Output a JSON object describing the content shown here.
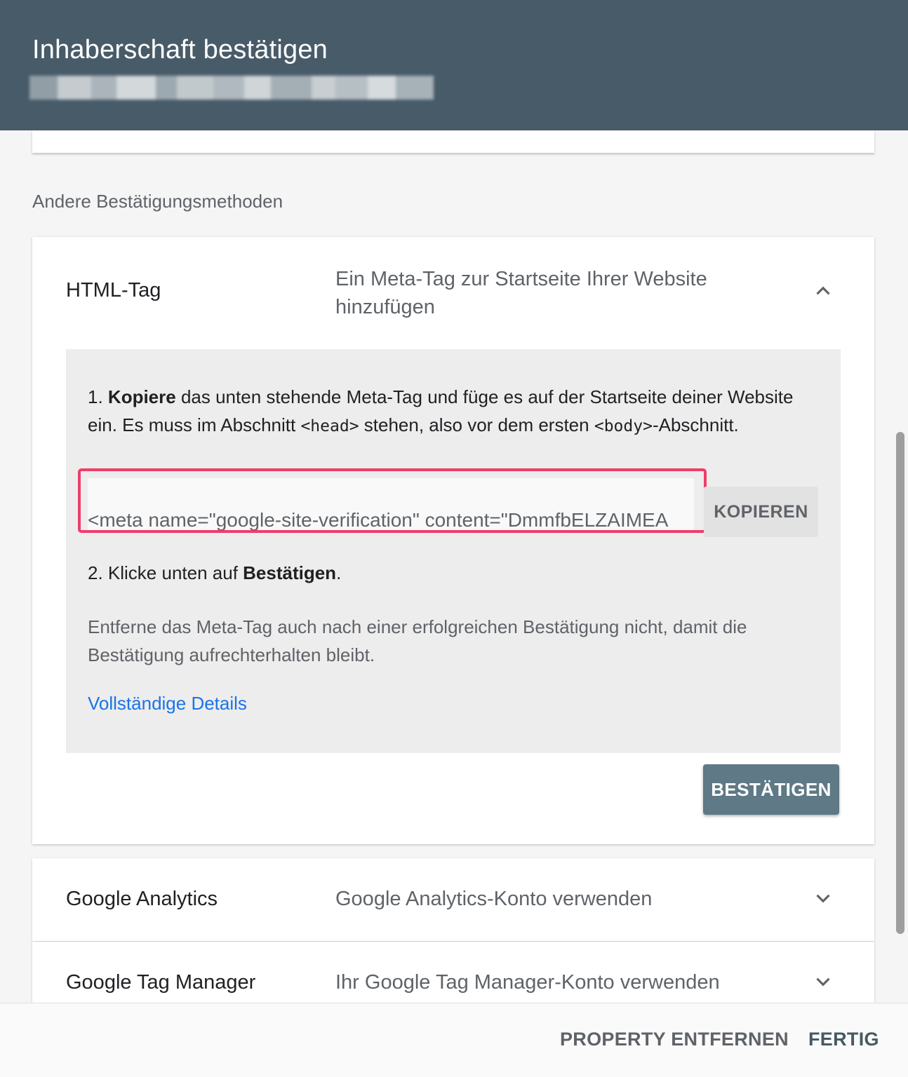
{
  "header": {
    "title": "Inhaberschaft bestätigen",
    "subtitle_redacted": true
  },
  "section": {
    "label": "Andere Bestätigungsmethoden"
  },
  "methods": [
    {
      "name": "HTML-Tag",
      "description": "Ein Meta-Tag zur Startseite Ihrer Website hinzufügen",
      "expanded": true,
      "chevron_icon": "chevron-up-icon"
    },
    {
      "name": "Google Analytics",
      "description": "Google Analytics-Konto verwenden",
      "expanded": false,
      "chevron_icon": "chevron-down-icon"
    },
    {
      "name": "Google Tag Manager",
      "description": "Ihr Google Tag Manager-Konto verwenden",
      "expanded": false,
      "chevron_icon": "chevron-down-icon"
    }
  ],
  "html_tag": {
    "step1": {
      "number": "1.",
      "bold": "Kopiere",
      "text_a": " das unten stehende Meta-Tag und füge es auf der Startseite deiner Website ein. Es muss im Abschnitt ",
      "code_head": "<head>",
      "text_b": " stehen, also vor dem ersten ",
      "code_body": "<body>",
      "text_c": "-Abschnitt."
    },
    "meta_value": "<meta name=\"google-site-verification\" content=\"DmmfbELZAIMEA",
    "copy_label": "KOPIEREN",
    "step2": {
      "prefix": "2. Klicke unten auf ",
      "bold": "Bestätigen",
      "suffix": "."
    },
    "note": "Entferne das Meta-Tag auch nach einer erfolgreichen Bestätigung nicht, damit die Bestätigung aufrechterhalten bleibt.",
    "details_link": "Vollständige Details",
    "confirm_label": "BESTÄTIGEN"
  },
  "footer": {
    "remove_label": "PROPERTY ENTFERNEN",
    "done_label": "FERTIG"
  },
  "colors": {
    "header_bg": "#485b68",
    "highlight": "#ef3d6b",
    "link": "#1a73e8",
    "confirm_bg": "#5f7986"
  }
}
